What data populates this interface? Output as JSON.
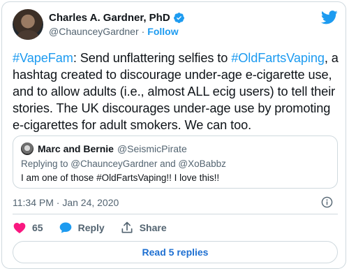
{
  "author": {
    "display_name": "Charles A. Gardner, PhD",
    "handle": "@ChaunceyGardner",
    "separator": "·",
    "follow_label": "Follow"
  },
  "tweet": {
    "segments": [
      {
        "text": "#VapeFam",
        "hashtag": true
      },
      {
        "text": ":  Send unflattering selfies to ",
        "hashtag": false
      },
      {
        "text": "#OldFartsVaping",
        "hashtag": true
      },
      {
        "text": ", a hashtag created to discourage under-age e-cigarette use, and to allow adults (i.e., almost ALL ecig users) to tell their stories.  The UK discourages under-age use by promoting e-cigarettes for adult smokers.  We can too.",
        "hashtag": false
      }
    ]
  },
  "quote": {
    "display_name": "Marc and Bernie",
    "handle": "@SeismicPirate",
    "replying_prefix": "Replying to ",
    "replying_to_1": "@ChaunceyGardner",
    "replying_and": " and ",
    "replying_to_2": "@XoBabbz",
    "body": "I am one of those #OldFartsVaping!! I love this!!"
  },
  "meta": {
    "timestamp": "11:34 PM · Jan 24, 2020"
  },
  "actions": {
    "like_count": "65",
    "reply_label": "Reply",
    "share_label": "Share"
  },
  "footer": {
    "read_replies_label": "Read 5 replies"
  },
  "colors": {
    "accent": "#1d9bf0",
    "like": "#f91880",
    "reply": "#1d9bf0",
    "text_secondary": "#536471",
    "border": "#cfd9de"
  },
  "icons": {
    "verified": "verified-badge-icon",
    "brand": "twitter-bird-icon",
    "info": "info-icon",
    "like": "heart-icon",
    "reply": "speech-bubble-icon",
    "share": "share-arrow-icon"
  }
}
